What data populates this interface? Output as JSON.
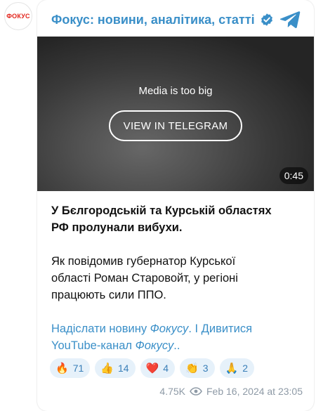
{
  "channel": {
    "avatar_text": "ФОКУС",
    "title": "Фокус: новини, аналітика, статті",
    "verified_icon": "verified-badge-icon",
    "share_icon": "telegram-share-icon",
    "accent": "#3a8fc8"
  },
  "media": {
    "message": "Media is too big",
    "button_label": "VIEW IN TELEGRAM",
    "duration": "0:45"
  },
  "post": {
    "headline_line1": "У Бєлгородській та Курській областях",
    "headline_line2": "РФ пролунали вибухи.",
    "body_line1": "Як повідомив губернатор Курської",
    "body_line2": "області Роман Старовойт, у регіоні",
    "body_line3": "працюють сили ППО.",
    "link1_text": "Надіслати новину ",
    "link1_italic": "Фокусу",
    "link1_end": ".",
    "separator": " I ",
    "link2_text_a": "Дивитися",
    "link2_text_b": "YouTube-канал ",
    "link2_italic": "Фокусу",
    "link2_end": ".."
  },
  "reactions": [
    {
      "emoji": "🔥",
      "count": "71"
    },
    {
      "emoji": "👍",
      "count": "14"
    },
    {
      "emoji": "❤️",
      "count": "4"
    },
    {
      "emoji": "👏",
      "count": "3"
    },
    {
      "emoji": "🙏",
      "count": "2"
    }
  ],
  "footer": {
    "views": "4.75K",
    "views_icon": "eye-icon",
    "date": "Feb 16, 2024 at 23:05"
  }
}
